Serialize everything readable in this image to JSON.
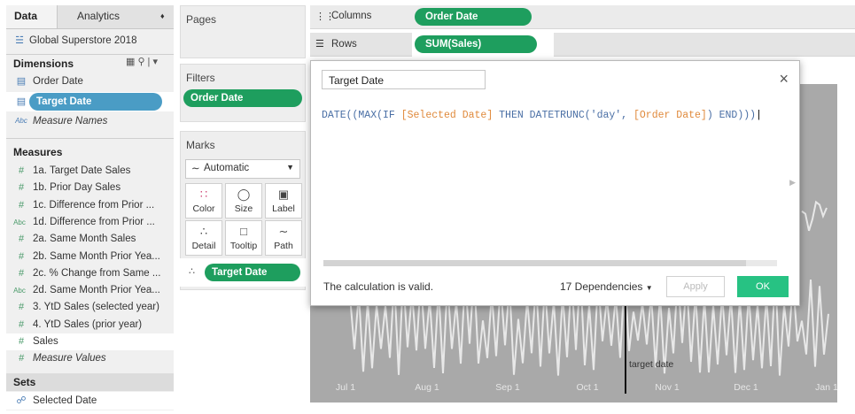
{
  "data_pane": {
    "tabs": [
      "Data",
      "Analytics"
    ],
    "datasource": "Global Superstore 2018",
    "dimensions_header": "Dimensions",
    "dimensions": [
      "Order Date",
      "Target Date",
      "Measure Names"
    ],
    "measures_header": "Measures",
    "measures": [
      "1a. Target Date Sales",
      "1b. Prior Day Sales",
      "1c. Difference from Prior ...",
      "1d. Difference from Prior ...",
      "2a. Same Month Sales",
      "2b. Same Month Prior Yea...",
      "2c. % Change from Same ...",
      "2d. Same Month Prior Yea...",
      "3. YtD Sales (selected year)",
      "4. YtD Sales (prior year)",
      "Sales",
      "Measure Values"
    ],
    "measure_icons": [
      "#",
      "#",
      "#",
      "Abc",
      "#",
      "#",
      "#",
      "Abc",
      "#",
      "#",
      "#",
      "#"
    ],
    "sets_header": "Sets",
    "sets": [
      "Selected Date"
    ]
  },
  "pages": {
    "title": "Pages"
  },
  "filters": {
    "title": "Filters",
    "pill": "Order Date"
  },
  "marks": {
    "title": "Marks",
    "type": "Automatic",
    "buttons": [
      "Color",
      "Size",
      "Label",
      "Detail",
      "Tooltip",
      "Path"
    ],
    "detail_pill": "Target Date"
  },
  "shelves": {
    "columns_label": "Columns",
    "columns_pill": "Order Date",
    "rows_label": "Rows",
    "rows_pill": "SUM(Sales)"
  },
  "calc_dialog": {
    "name": "Target Date",
    "formula_tokens": [
      {
        "t": "DATE((MAX(IF ",
        "c": "#4a6fa5"
      },
      {
        "t": "[Selected Date]",
        "c": "#e08a3c"
      },
      {
        "t": " THEN DATETRUNC('day', ",
        "c": "#4a6fa5"
      },
      {
        "t": "[Order Date]",
        "c": "#e08a3c"
      },
      {
        "t": ") END)))",
        "c": "#4a6fa5"
      }
    ],
    "status": "The calculation is valid.",
    "dependencies": "17 Dependencies",
    "apply_label": "Apply",
    "ok_label": "OK"
  },
  "chart_data": {
    "type": "line",
    "x_ticks": [
      "Jul 1",
      "Aug 1",
      "Sep 1",
      "Oct 1",
      "Nov 1",
      "Dec 1",
      "Jan 1"
    ],
    "annotation": "target date"
  }
}
